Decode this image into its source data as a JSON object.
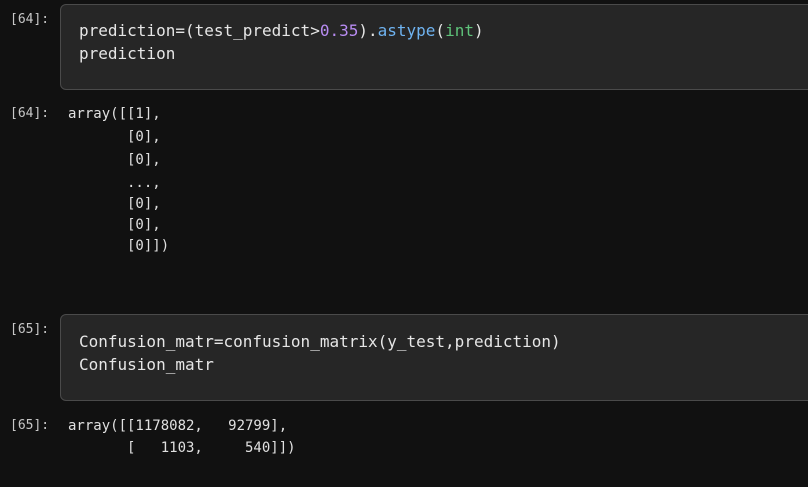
{
  "cells": [
    {
      "in_prompt": "[64]:",
      "code": {
        "line1": {
          "a": "prediction=(test_predict>",
          "num": "0.35",
          "b": ").",
          "method": "astype",
          "c": "(",
          "builtin": "int",
          "d": ")"
        },
        "line2": "prediction"
      },
      "out_prompt": "[64]:",
      "output": [
        "array([[1],",
        "       [0],",
        "       [0],",
        "       ...,",
        "       [0],",
        "       [0],",
        "       [0]])"
      ]
    },
    {
      "in_prompt": "[65]:",
      "code": {
        "line1": "Confusion_matr=confusion_matrix(y_test,prediction)",
        "line2": "Confusion_matr"
      },
      "out_prompt": "[65]:",
      "output": [
        "array([[1178082,   92799],",
        "       [   1103,     540]])"
      ]
    }
  ],
  "colors": {
    "background": "#111111",
    "cell_bg": "#262626",
    "cell_border": "#4a4a4a",
    "number": "#b88cf2",
    "method": "#6fb3f0",
    "builtin": "#5ec27a"
  }
}
